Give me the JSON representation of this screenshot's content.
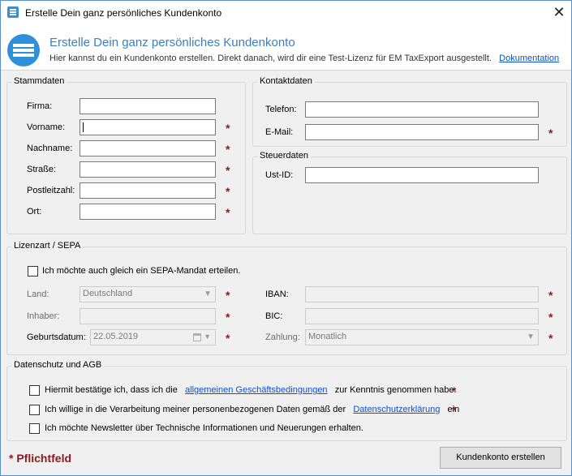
{
  "window": {
    "title": "Erstelle Dein ganz persönliches Kundenkonto"
  },
  "header": {
    "title": "Erstelle Dein ganz persönliches Kundenkonto",
    "subtitle": "Hier kannst du ein Kundenkonto erstellen. Direkt danach, wird dir eine Test-Lizenz für EM TaxExport ausgestellt.",
    "doc_link": "Dokumentation"
  },
  "stammdaten": {
    "title": "Stammdaten",
    "firma": "Firma:",
    "vorname": "Vorname:",
    "nachname": "Nachname:",
    "strasse": "Straße:",
    "plz": "Postleitzahl:",
    "ort": "Ort:"
  },
  "kontaktdaten": {
    "title": "Kontaktdaten",
    "telefon": "Telefon:",
    "email": "E-Mail:"
  },
  "steuerdaten": {
    "title": "Steuerdaten",
    "ustid": "Ust-ID:"
  },
  "sepa": {
    "title": "Lizenzart / SEPA",
    "checkbox": "Ich möchte auch gleich ein SEPA-Mandat erteilen.",
    "land_label": "Land:",
    "land_value": "Deutschland",
    "inhaber_label": "Inhaber:",
    "geburtsdatum_label": "Geburtsdatum:",
    "geburtsdatum_value": "22.05.2019",
    "iban_label": "IBAN:",
    "bic_label": "BIC:",
    "zahlung_label": "Zahlung:",
    "zahlung_value": "Monatlich"
  },
  "datenschutz": {
    "title": "Datenschutz und AGB",
    "agb_pre": "Hiermit bestätige ich, dass ich die",
    "agb_link": "allgemeinen Geschäftsbedingungen",
    "agb_post": "zur Kenntnis genommen habe.",
    "ds_pre": "Ich willige in die Verarbeitung meiner personenbezogenen Daten gemäß der",
    "ds_link": "Datenschutzerklärung",
    "ds_post": "ein",
    "newsletter": "Ich möchte Newsletter über Technische Informationen und Neuerungen erhalten."
  },
  "footer": {
    "required": "* Pflichtfeld",
    "submit": "Kundenkonto erstellen"
  },
  "required_mark": "*"
}
